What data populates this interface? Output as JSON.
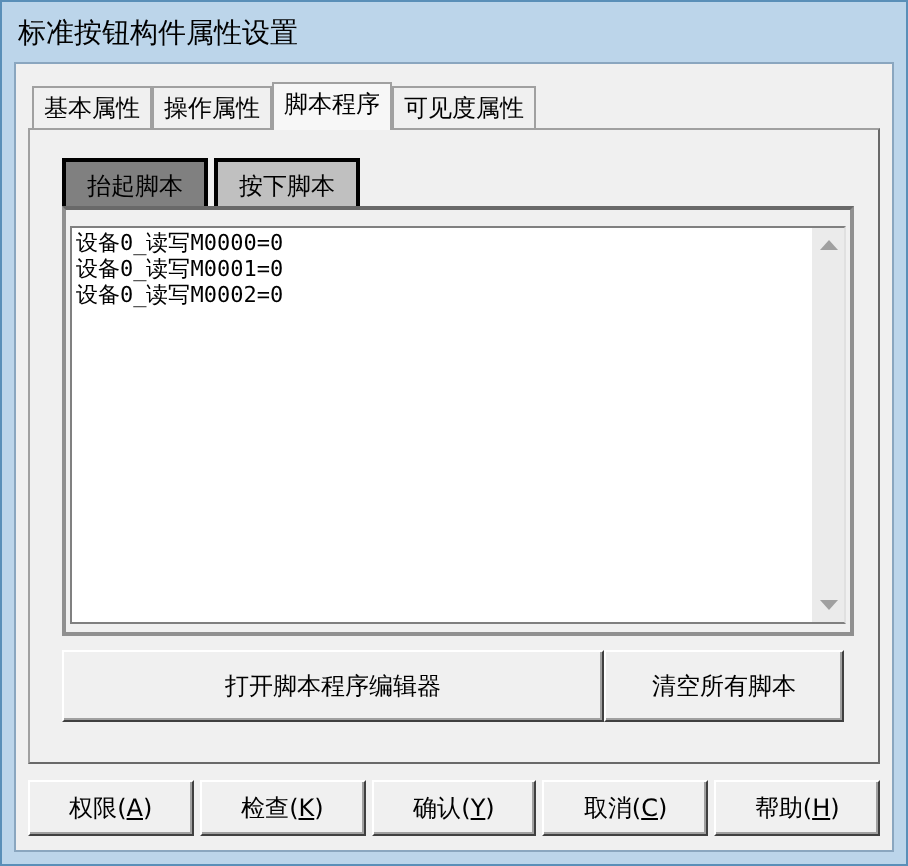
{
  "window": {
    "title": "标准按钮构件属性设置"
  },
  "tabs": [
    {
      "label": "基本属性",
      "selected": false
    },
    {
      "label": "操作属性",
      "selected": false
    },
    {
      "label": "脚本程序",
      "selected": true
    },
    {
      "label": "可见度属性",
      "selected": false
    }
  ],
  "script_tabs": [
    {
      "label": "抬起脚本",
      "selected": true
    },
    {
      "label": "按下脚本",
      "selected": false
    }
  ],
  "script_lines": [
    "设备0_读写M0000=0",
    "设备0_读写M0001=0",
    "设备0_读写M0002=0"
  ],
  "script_actions": [
    "打开脚本程序编辑器",
    "清空所有脚本"
  ],
  "buttons": [
    {
      "before": "权限(",
      "key": "A",
      "after": ")"
    },
    {
      "before": "检查(",
      "key": "K",
      "after": ")"
    },
    {
      "before": "确认(",
      "key": "Y",
      "after": ")"
    },
    {
      "before": "取消(",
      "key": "C",
      "after": ")"
    },
    {
      "before": "帮助(",
      "key": "H",
      "after": ")"
    }
  ]
}
